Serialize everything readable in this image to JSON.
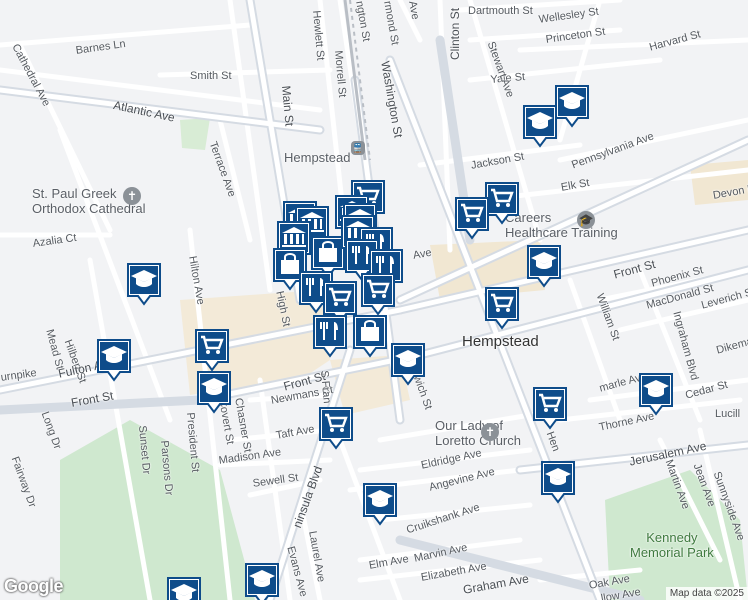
{
  "map": {
    "attribution": "Map data ©2025",
    "logo": "Google",
    "city_label": "Hempstead",
    "streets": [
      {
        "id": "dartmouth-st",
        "text": "Dartmouth St"
      },
      {
        "id": "wellesley-st",
        "text": "Wellesley St"
      },
      {
        "id": "princeton-st",
        "text": "Princeton St"
      },
      {
        "id": "harvard-st",
        "text": "Harvard St"
      },
      {
        "id": "yale-st",
        "text": "Yale St"
      },
      {
        "id": "stewart-ave",
        "text": "Stewart Ave"
      },
      {
        "id": "barnes-ln",
        "text": "Barnes Ln"
      },
      {
        "id": "cathedral-ave",
        "text": "Cathedral Ave"
      },
      {
        "id": "smith-st",
        "text": "Smith St"
      },
      {
        "id": "atlantic-ave",
        "text": "Atlantic Ave"
      },
      {
        "id": "hewlett-st",
        "text": "Hewlett St"
      },
      {
        "id": "morrell-st",
        "text": "Morrell St"
      },
      {
        "id": "washington-st-top",
        "text": "ngton St"
      },
      {
        "id": "washington-st",
        "text": "Washington St"
      },
      {
        "id": "clinton-st",
        "text": "Clinton St"
      },
      {
        "id": "main-st",
        "text": "Main St"
      },
      {
        "id": "terrace-ave",
        "text": "Terrace Ave"
      },
      {
        "id": "jackson-st",
        "text": "Jackson St"
      },
      {
        "id": "pennsylvania-ave",
        "text": "Pennsylvania Ave"
      },
      {
        "id": "elk-st",
        "text": "Elk St"
      },
      {
        "id": "devon-rd",
        "text": "Devon R"
      },
      {
        "id": "azalia-ct",
        "text": "Azalia Ct"
      },
      {
        "id": "hilton-ave",
        "text": "Hilton Ave"
      },
      {
        "id": "front-st-east",
        "text": "Front St"
      },
      {
        "id": "phoenix-st",
        "text": "Phoenix St"
      },
      {
        "id": "macdonald-st",
        "text": "MacDonald St"
      },
      {
        "id": "leverich-st",
        "text": "Leverich S"
      },
      {
        "id": "william-st",
        "text": "William St"
      },
      {
        "id": "ingraham-blvd",
        "text": "Ingraham Blvd"
      },
      {
        "id": "dikeman",
        "text": "Dikema"
      },
      {
        "id": "hilbert-st",
        "text": "Hilbert St"
      },
      {
        "id": "mead-st",
        "text": "Mead St"
      },
      {
        "id": "turnpike",
        "text": "urnpike"
      },
      {
        "id": "fulton-ave",
        "text": "Fulton Ave"
      },
      {
        "id": "front-st-west",
        "text": "Front St"
      },
      {
        "id": "long-dr",
        "text": "Long Dr"
      },
      {
        "id": "high-st",
        "text": "High St"
      },
      {
        "id": "front-st-center",
        "text": "Front St"
      },
      {
        "id": "newmans-ct",
        "text": "Newmans Ct"
      },
      {
        "id": "greenwich-st",
        "text": "nwich St"
      },
      {
        "id": "marle-ave",
        "text": "marle Ave"
      },
      {
        "id": "cedar-st",
        "text": "Cedar St"
      },
      {
        "id": "lucille",
        "text": "Lucill"
      },
      {
        "id": "thorne-ave",
        "text": "Thorne Ave"
      },
      {
        "id": "fairway-dr",
        "text": "Fairway Dr"
      },
      {
        "id": "sunset-dr",
        "text": "Sunset Dr"
      },
      {
        "id": "parsons-dr",
        "text": "Parsons Dr"
      },
      {
        "id": "president-st",
        "text": "President St"
      },
      {
        "id": "covert-st",
        "text": "Covert St"
      },
      {
        "id": "chasner-st",
        "text": "Chasner St"
      },
      {
        "id": "s-franklin",
        "text": "S Fran"
      },
      {
        "id": "taft-ave",
        "text": "Taft Ave"
      },
      {
        "id": "madison-ave",
        "text": "Madison Ave"
      },
      {
        "id": "henry-st",
        "text": "Hen"
      },
      {
        "id": "jerusalem-ave",
        "text": "Jerusalem Ave"
      },
      {
        "id": "sunnyside-ave",
        "text": "Sunnyside Ave"
      },
      {
        "id": "jean-ave",
        "text": "Jean Ave"
      },
      {
        "id": "martin-ave",
        "text": "Martin Ave"
      },
      {
        "id": "sewell-st",
        "text": "Sewell St"
      },
      {
        "id": "eldridge-ave",
        "text": "Eldridge Ave"
      },
      {
        "id": "angevine-ave",
        "text": "Angevine Ave"
      },
      {
        "id": "peninsula-blvd",
        "text": "ninsula Blvd"
      },
      {
        "id": "laurel-ave",
        "text": "Laurel Ave"
      },
      {
        "id": "cruikshank-ave",
        "text": "Cruikshank Ave"
      },
      {
        "id": "evans-ave",
        "text": "Evans Ave"
      },
      {
        "id": "marvin-ave",
        "text": "Marvin Ave"
      },
      {
        "id": "elm-ave",
        "text": "Elm Ave"
      },
      {
        "id": "elizabeth-ave",
        "text": "Elizabeth Ave"
      },
      {
        "id": "graham-ave",
        "text": "Graham Ave"
      },
      {
        "id": "oak-ave",
        "text": "Oak Ave"
      },
      {
        "id": "willow-ave",
        "text": "llow Ave"
      },
      {
        "id": "dermond-st",
        "text": "rmond St"
      },
      {
        "id": "ave-top",
        "text": "Ave"
      },
      {
        "id": "ave-mid",
        "text": "Ave"
      }
    ],
    "pois": [
      {
        "id": "hempstead-station",
        "text": "Hempstead",
        "icon": "train-station-icon"
      },
      {
        "id": "st-paul-cathedral",
        "text": "St. Paul Greek\nOrthodox Cathedral",
        "icon": "church-icon"
      },
      {
        "id": "careers-training",
        "text": "Careers\nHealthcare Training",
        "icon": "school-poi-icon"
      },
      {
        "id": "our-lady-loretto",
        "text": "Our Lady of\nLoretto Church",
        "icon": "church-icon"
      },
      {
        "id": "kennedy-park",
        "text": "Kennedy\nMemorial Park",
        "icon": ""
      }
    ],
    "marker_types": {
      "grocery": "shopping-cart-icon",
      "school": "graduation-cap-icon",
      "restaurant": "fork-knife-icon",
      "shopping": "shopping-bag-icon",
      "library": "columns-icon"
    },
    "colors": {
      "marker_fill": "#0e4c8a",
      "marker_inner": "#ffffff",
      "road": "#ffffff",
      "major_road": "#d5dbe3",
      "commercial_area": "#f3ead8",
      "park": "#cfe8cf",
      "background": "#f2f3f5"
    }
  }
}
